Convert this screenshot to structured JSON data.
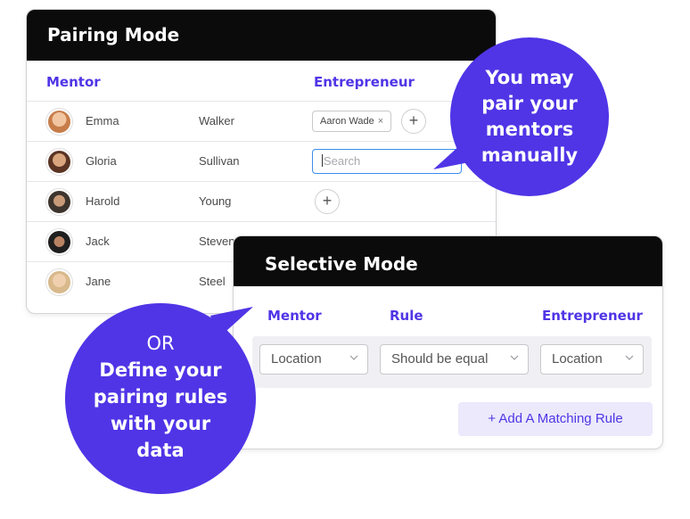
{
  "pairing_mode": {
    "title": "Pairing Mode",
    "mentor_header": "Mentor",
    "entrepreneur_header": "Entrepreneur",
    "rows": [
      {
        "first": "Emma",
        "last": "Walker",
        "tag": "Aaron Wade",
        "tag_close": "×"
      },
      {
        "first": "Gloria",
        "last": "Sullivan",
        "search_placeholder": "Search"
      },
      {
        "first": "Harold",
        "last": "Young"
      },
      {
        "first": "Jack",
        "last": "Steven"
      },
      {
        "first": "Jane",
        "last": "Steel"
      }
    ],
    "plus_symbol": "+"
  },
  "selective_mode": {
    "title": "Selective Mode",
    "mentor_header": "Mentor",
    "rule_header": "Rule",
    "entrepreneur_header": "Entrepreneur",
    "mentor_field": "Location",
    "rule_value": "Should be equal",
    "entrepreneur_field": "Location",
    "add_rule_label": "+ Add A Matching Rule"
  },
  "bubbles": {
    "manual_lines": [
      "You may",
      "pair your",
      "mentors",
      "manually"
    ],
    "rules_or": "OR",
    "rules_lines": [
      "Define your",
      "pairing rules",
      "with your",
      "data"
    ]
  },
  "colors": {
    "accent": "#4f35e6",
    "header_bg": "#0b0b0b",
    "search_border": "#3a8eea"
  },
  "avatar_colors": [
    "#d89a6a",
    "#7a4b33",
    "#5a4a3e",
    "#2e2e2e",
    "#c9a27a"
  ]
}
